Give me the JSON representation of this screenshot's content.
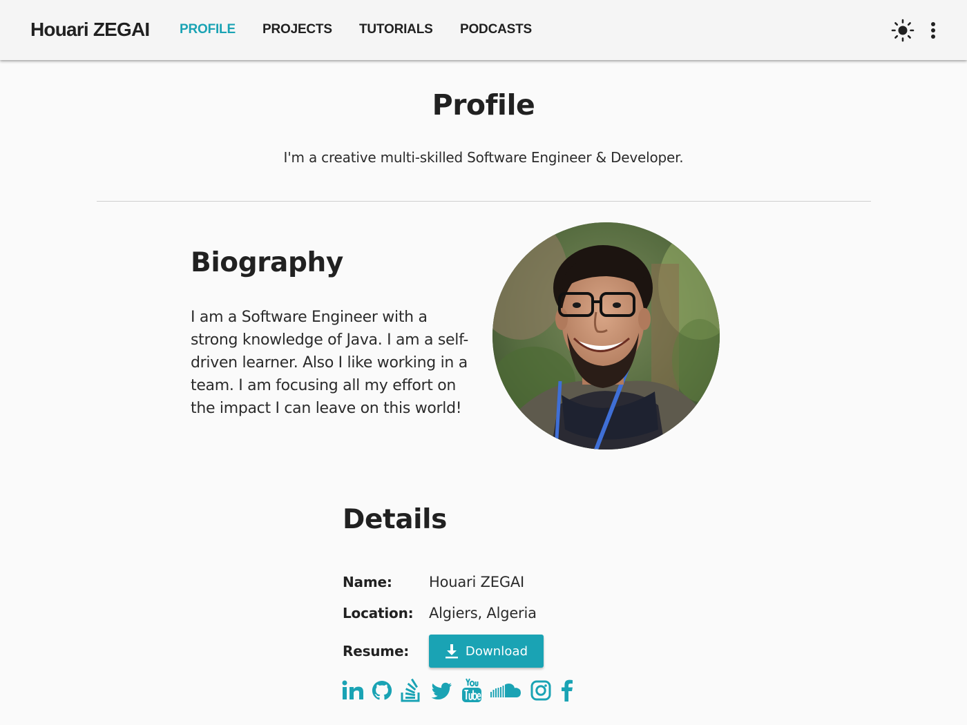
{
  "header": {
    "brand": "Houari ZEGAI",
    "tabs": [
      {
        "label": "PROFILE",
        "active": true
      },
      {
        "label": "PROJECTS",
        "active": false
      },
      {
        "label": "TUTORIALS",
        "active": false
      },
      {
        "label": "PODCASTS",
        "active": false
      }
    ],
    "actions": [
      {
        "icon": "sun-icon"
      },
      {
        "icon": "more-vertical-icon"
      }
    ]
  },
  "profile": {
    "title": "Profile",
    "tagline": "I'm a creative multi-skilled Software Engineer & Developer."
  },
  "biography": {
    "heading": "Biography",
    "text": "I am a Software Engineer with a strong knowledge of Java. I am a self-driven learner. Also I like working in a team. I am focusing all my effort on the impact I can leave on this world!",
    "photo": "profile-photo"
  },
  "details": {
    "heading": "Details",
    "name_label": "Name:",
    "name_value": "Houari ZEGAI",
    "location_label": "Location:",
    "location_value": "Algiers, Algeria",
    "resume_label": "Resume:",
    "download_label": "Download"
  },
  "social": [
    "linkedin-icon",
    "github-icon",
    "stackoverflow-icon",
    "twitter-icon",
    "youtube-icon",
    "soundcloud-icon",
    "instagram-icon",
    "facebook-icon"
  ],
  "colors": {
    "accent": "#1aa3b4",
    "text": "#212121",
    "background": "#fafafa",
    "appbar": "#f5f5f5"
  }
}
